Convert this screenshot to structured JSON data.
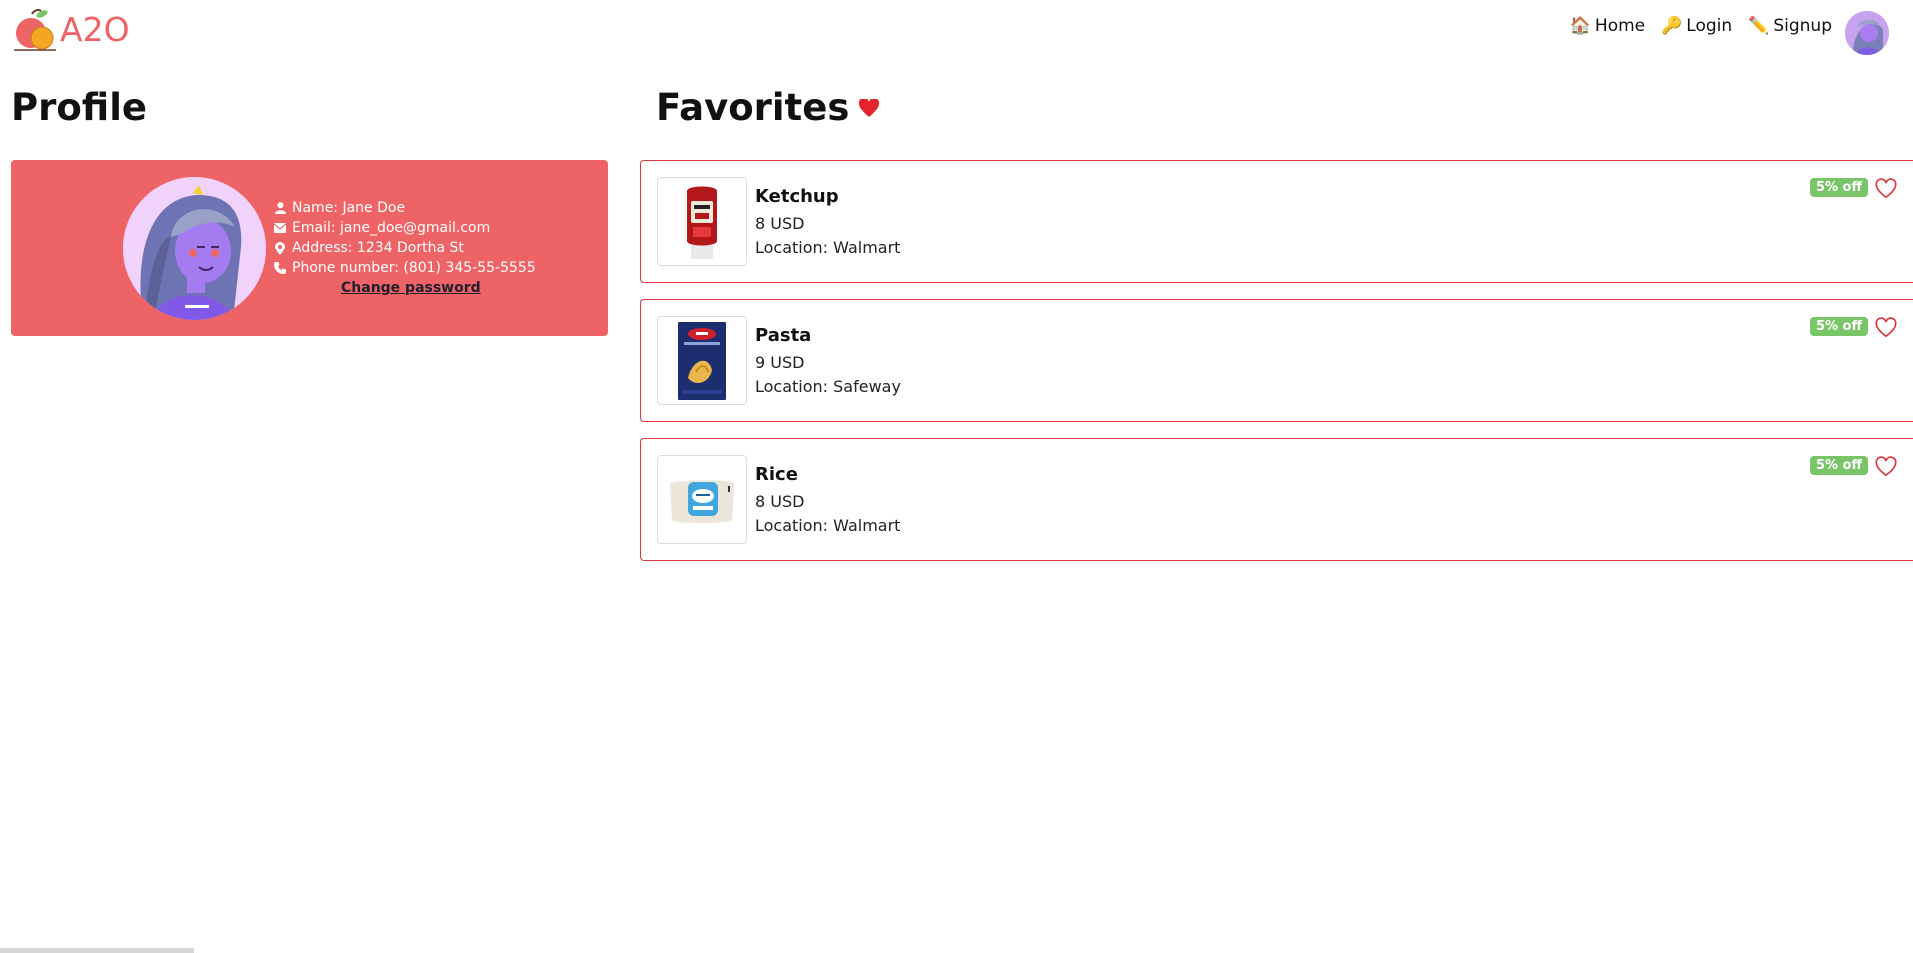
{
  "brand": {
    "logo_text": "A2O",
    "accent_color": "#ee6466"
  },
  "nav": {
    "items": [
      {
        "icon": "house-icon",
        "emoji": "🏠",
        "label": "Home"
      },
      {
        "icon": "key-icon",
        "emoji": "🔑",
        "label": "Login"
      },
      {
        "icon": "pencil-icon",
        "emoji": "✏️",
        "label": "Signup"
      }
    ],
    "avatar_icon": "user-avatar"
  },
  "profile": {
    "title": "Profile",
    "card_color": "#ee6466",
    "name": "Name: Jane Doe",
    "email": "Email: jane_doe@gmail.com",
    "address": "Address: 1234 Dortha St",
    "phone": "Phone number: (801) 345-55-5555",
    "change_password": "Change password"
  },
  "favorites": {
    "title": "Favorites",
    "title_icon": "heart-filled-icon",
    "items": [
      {
        "name": "Ketchup",
        "price": "8 USD",
        "location": "Location: Walmart",
        "badge": "5% off",
        "image": "ketchup-bottle"
      },
      {
        "name": "Pasta",
        "price": "9 USD",
        "location": "Location: Safeway",
        "badge": "5% off",
        "image": "pasta-box"
      },
      {
        "name": "Rice",
        "price": "8 USD",
        "location": "Location: Walmart",
        "badge": "5% off",
        "image": "rice-bag"
      }
    ],
    "border_color": "#d9363e",
    "badge_color": "#7ac46a"
  }
}
